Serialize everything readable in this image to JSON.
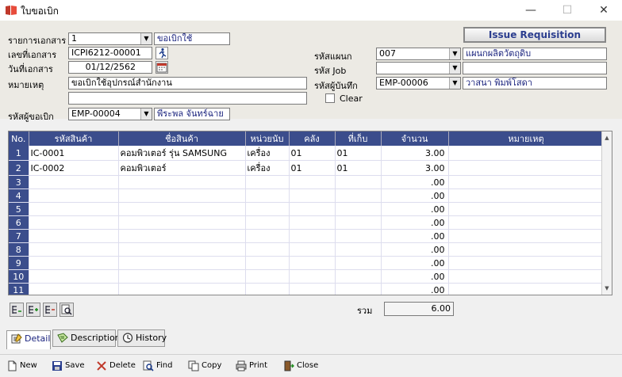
{
  "window": {
    "title": "ใบขอเบิก",
    "min": "—",
    "max": "☐",
    "close": "✕"
  },
  "form": {
    "doc_type_label": "รายการเอกสาร",
    "doc_type_value": "1",
    "doc_type_desc": "ขอเบิกใช้",
    "issue_button": "Issue Requisition",
    "doc_no_label": "เลขที่เอกสาร",
    "doc_no_value": "ICPI6212-00001",
    "doc_date_label": "วันที่เอกสาร",
    "doc_date_value": "01/12/2562",
    "remark_label": "หมายเหตุ",
    "remark_value": "ขอเบิกใช้อุปกรณ์สำนักงาน",
    "remark2_value": "",
    "requester_label": "รหัสผู้ขอเบิก",
    "requester_code": "EMP-00004",
    "requester_name": "พีระพล จันทร์ฉาย",
    "dept_label": "รหัสแผนก",
    "dept_code": "007",
    "dept_name": "แผนกผลิตวัตถุดิบ",
    "job_label": "รหัส Job",
    "job_code": "",
    "job_name": "",
    "recorder_label": "รหัสผู้บันทึก",
    "recorder_code": "EMP-00006",
    "recorder_name": "วาสนา พิมพ์โสดา",
    "clear_label": "Clear"
  },
  "grid": {
    "headers": [
      "No.",
      "รหัสสินค้า",
      "ชื่อสินค้า",
      "หน่วยนับ",
      "คลัง",
      "ที่เก็บ",
      "จำนวน",
      "หมายเหตุ"
    ],
    "rows": [
      [
        "1",
        "IC-0001",
        "คอมพิวเตอร์ รุ่น SAMSUNG",
        "เครื่อง",
        "01",
        "01",
        "3.00",
        ""
      ],
      [
        "2",
        "IC-0002",
        "คอมพิวเตอร์",
        "เครื่อง",
        "01",
        "01",
        "3.00",
        ""
      ],
      [
        "3",
        "",
        "",
        "",
        "",
        "",
        ".00",
        ""
      ],
      [
        "4",
        "",
        "",
        "",
        "",
        "",
        ".00",
        ""
      ],
      [
        "5",
        "",
        "",
        "",
        "",
        "",
        ".00",
        ""
      ],
      [
        "6",
        "",
        "",
        "",
        "",
        "",
        ".00",
        ""
      ],
      [
        "7",
        "",
        "",
        "",
        "",
        "",
        ".00",
        ""
      ],
      [
        "8",
        "",
        "",
        "",
        "",
        "",
        ".00",
        ""
      ],
      [
        "9",
        "",
        "",
        "",
        "",
        "",
        ".00",
        ""
      ],
      [
        "10",
        "",
        "",
        "",
        "",
        "",
        ".00",
        ""
      ],
      [
        "11",
        "",
        "",
        "",
        "",
        "",
        ".00",
        ""
      ]
    ]
  },
  "total": {
    "label": "รวม",
    "value": "6.00"
  },
  "tabs": [
    "Detail",
    "Description",
    "History"
  ],
  "toolbar": [
    "New",
    "Save",
    "Delete",
    "Find",
    "Copy",
    "Print",
    "Close"
  ],
  "colors": {
    "header_bg": "#3b4d8c",
    "accent_text": "#2c3e8f",
    "panel_bg": "#eceae4"
  }
}
